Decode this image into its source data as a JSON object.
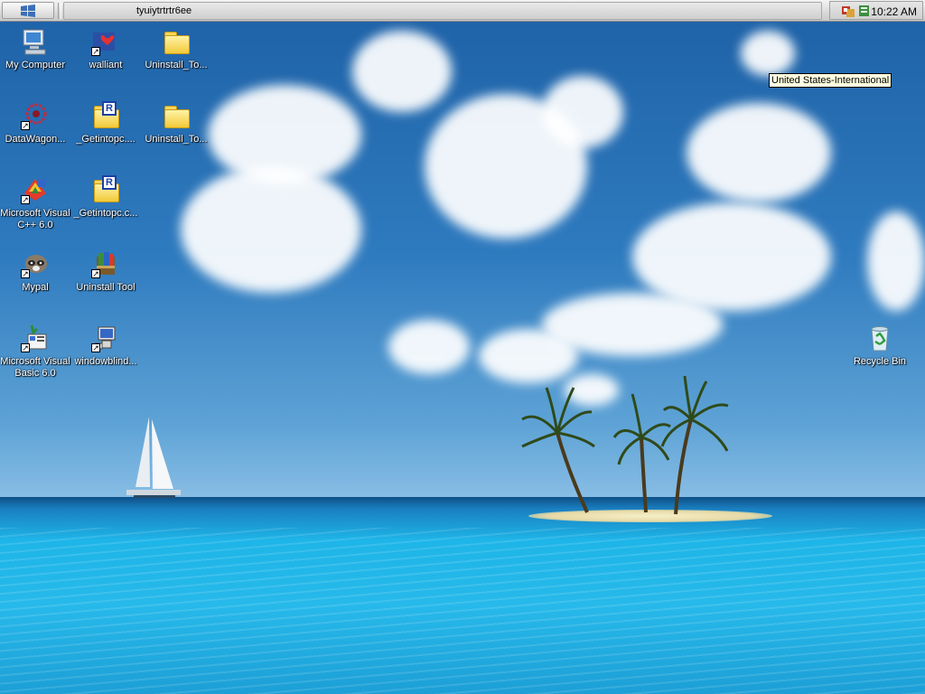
{
  "taskbar": {
    "task_title": "tyuiytrtrtr6ee",
    "clock": "10:22 AM"
  },
  "tooltip": {
    "text": "United States-International"
  },
  "icons": [
    {
      "label": "My Computer"
    },
    {
      "label": "walliant"
    },
    {
      "label": "Uninstall_To..."
    },
    {
      "label": "DataWagon..."
    },
    {
      "label": "_Getintopc...."
    },
    {
      "label": "Uninstall_To..."
    },
    {
      "label": "Microsoft Visual C++ 6.0"
    },
    {
      "label": "_Getintopc.c..."
    },
    {
      "label": "Mypal"
    },
    {
      "label": "Uninstall Tool"
    },
    {
      "label": "Microsoft Visual Basic 6.0"
    },
    {
      "label": "windowblind..."
    },
    {
      "label": "Recycle Bin"
    }
  ]
}
